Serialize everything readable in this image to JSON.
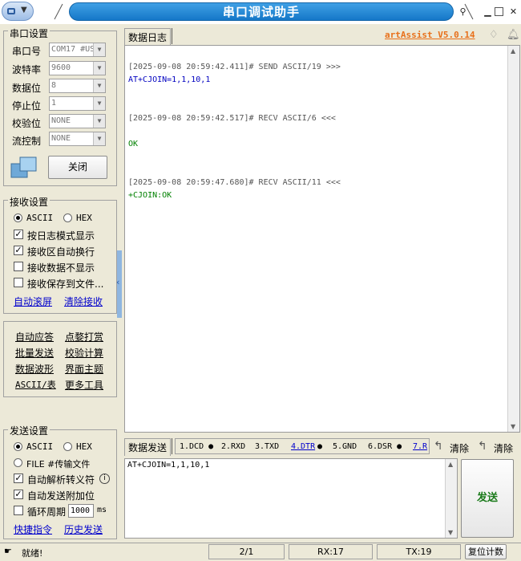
{
  "window": {
    "title": "串口调试助手"
  },
  "serial": {
    "title": "串口设置",
    "port_label": "串口号",
    "port_value": "COM17 #US",
    "baud_label": "波特率",
    "baud_value": "9600",
    "databits_label": "数据位",
    "databits_value": "8",
    "stopbits_label": "停止位",
    "stopbits_value": "1",
    "parity_label": "校验位",
    "parity_value": "NONE",
    "flow_label": "流控制",
    "flow_value": "NONE",
    "close_button": "关闭"
  },
  "recv": {
    "title": "接收设置",
    "ascii": "ASCII",
    "hex": "HEX",
    "opt1": "按日志模式显示",
    "opt2": "接收区自动换行",
    "opt3": "接收数据不显示",
    "opt4": "接收保存到文件...",
    "auto_scroll": "自动滚屏",
    "clear_recv": "清除接收"
  },
  "tools": {
    "t1": "自动应答",
    "t2": "点婺打赏",
    "t3": "批量发送",
    "t4": "校验计算",
    "t5": "数据波形",
    "t6": "界面主题",
    "t7": "ASCII/表",
    "t8": "更多工具"
  },
  "send": {
    "title": "发送设置",
    "ascii": "ASCII",
    "hex": "HEX",
    "file": "FILE #传输文件",
    "opt1": "自动解析转义符",
    "opt2": "自动发送附加位",
    "opt3": "循环周期",
    "period": "1000",
    "period_unit": "ms",
    "shortcut": "快捷指令",
    "history": "历史发送"
  },
  "log_tab": "数据日志",
  "brand": "artAssist V5.0.14",
  "log": [
    {
      "text": "[2025-09-08 20:59:42.411]# SEND ASCII/19 >>>",
      "color": "#555555"
    },
    {
      "text": "AT+CJOIN=1,1,10,1",
      "color": "#0000c0"
    },
    {
      "text": "[2025-09-08 20:59:42.517]# RECV ASCII/6 <<<",
      "color": "#555555"
    },
    {
      "text": "OK",
      "color": "#008000"
    },
    {
      "text": "[2025-09-08 20:59:47.680]# RECV ASCII/11 <<<",
      "color": "#555555"
    },
    {
      "text": "+CJOIN:OK",
      "color": "#008000"
    }
  ],
  "send_tab": "数据发送",
  "signals": [
    "1.DCD",
    "2.RXD",
    "3.TXD",
    "4.DTR",
    "5.GND",
    "6.DSR",
    "7.R"
  ],
  "clear1": "清除",
  "clear2": "清除",
  "send_text": "AT+CJOIN=1,1,10,1",
  "send_button": "发送",
  "status": {
    "ready": "就绪!",
    "page": "2/1",
    "rx": "RX:17",
    "tx": "TX:19",
    "reset": "复位计数"
  }
}
